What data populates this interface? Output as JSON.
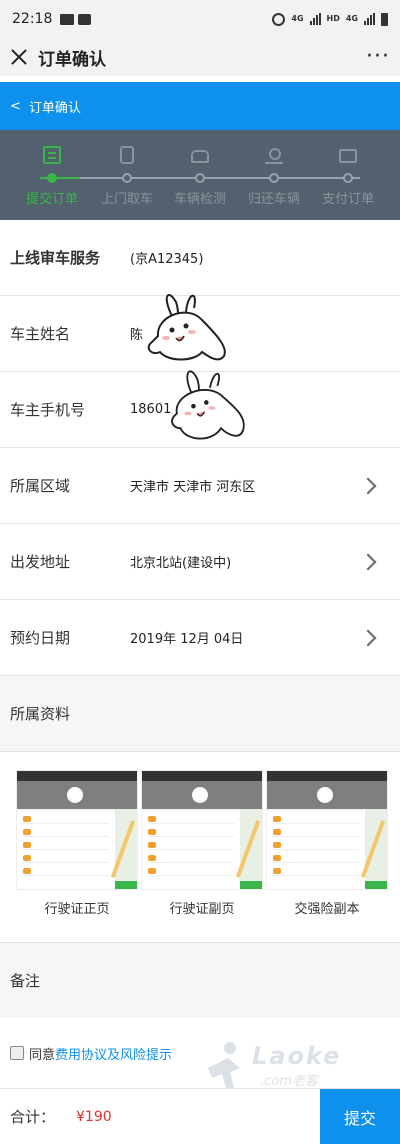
{
  "status_bar": {
    "time": "22:18",
    "network_a": "4G",
    "network_b": "HD",
    "network_c": "4G"
  },
  "title_bar": {
    "title": "订单确认",
    "more": "···"
  },
  "blue_bar": {
    "back": "<",
    "title": "订单确认"
  },
  "steps": [
    {
      "label": "提交订单",
      "active": true,
      "icon": "document-icon"
    },
    {
      "label": "上门取车",
      "active": false,
      "icon": "phone-icon"
    },
    {
      "label": "车辆检测",
      "active": false,
      "icon": "car-icon"
    },
    {
      "label": "归还车辆",
      "active": false,
      "icon": "key-icon"
    },
    {
      "label": "支付订单",
      "active": false,
      "icon": "wallet-icon"
    }
  ],
  "form": {
    "service": {
      "label": "上线审车服务",
      "value": "(京A12345)"
    },
    "owner_name": {
      "label": "车主姓名",
      "value": "陈"
    },
    "owner_phone": {
      "label": "车主手机号",
      "value": "18601"
    },
    "region": {
      "label": "所属区域",
      "value": "天津市 天津市 河东区"
    },
    "address": {
      "label": "出发地址",
      "value": "北京北站(建设中)"
    },
    "date": {
      "label": "预约日期",
      "value": "2019年 12月 04日"
    }
  },
  "materials": {
    "heading": "所属资料",
    "docs": [
      {
        "caption": "行驶证正页"
      },
      {
        "caption": "行驶证副页"
      },
      {
        "caption": "交强险副本"
      }
    ]
  },
  "remark": {
    "label": "备注"
  },
  "agreement": {
    "prefix": "同意",
    "link": "费用协议及风险提示"
  },
  "footer": {
    "total_label": "合计：",
    "total_value": "¥190",
    "submit": "提交"
  },
  "watermark": {
    "brand": "Laoke",
    "domain": ".com老客"
  },
  "colors": {
    "accent": "#0e91ec",
    "step_active": "#39b54a",
    "stepper_bg": "#53606d",
    "price": "#e03030"
  }
}
